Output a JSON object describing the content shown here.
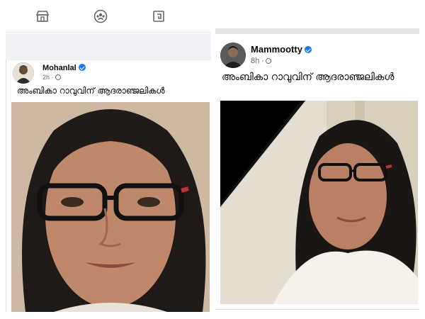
{
  "left_post": {
    "nav_icons": [
      "store-icon",
      "groups-icon",
      "gaming-icon"
    ],
    "author": "Mohanlal",
    "time": "2h ·",
    "caption": "അംബികാ റാവുവിന് ആദരാഞ്ജലികൾ"
  },
  "right_post": {
    "author": "Mammootty",
    "time": "8h ·",
    "caption": "അംബികാ റാവുവിന് ആദരാഞ്ജലികൾ"
  },
  "colors": {
    "verified": "#1877f2",
    "meta": "#65676b",
    "mourning_ribbon": "#000000"
  }
}
